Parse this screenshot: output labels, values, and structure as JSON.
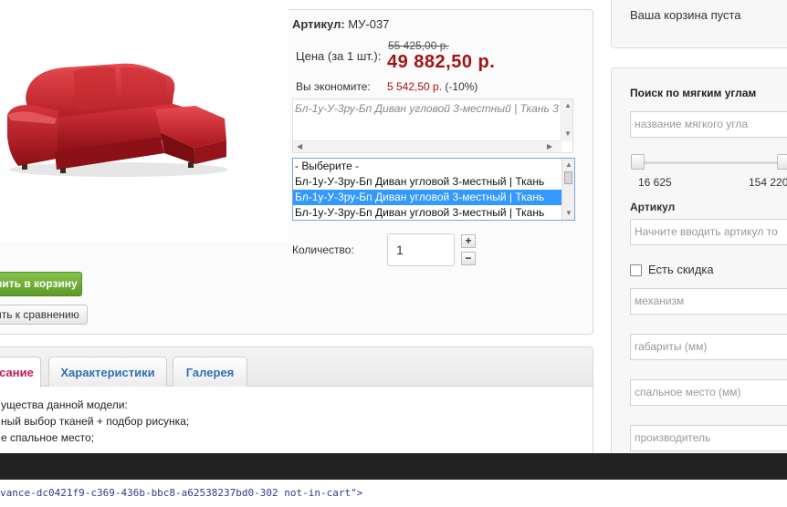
{
  "product": {
    "sku_label": "Артикул:",
    "sku_value": "МУ-037",
    "price_label": "Цена (за 1 шт.):",
    "old_price": "55 425,00 р.",
    "new_price": "49 882,50 р.",
    "save_label": "Вы экономите:",
    "save_amount": "5 542,50 р.",
    "save_percent": "(-10%)",
    "description": "Бл-1у-У-3ру-Бп Диван угловой 3-местный | Ткань 3",
    "variant_options": [
      "- Выберите -",
      "Бл-1у-У-3ру-Бп Диван угловой 3-местный | Ткань",
      "Бл-1у-У-3ру-Бп Диван угловой 3-местный | Ткань",
      "Бл-1у-У-3ру-Бп Диван угловой 3-местный | Ткань"
    ],
    "selected_variant_index": 2,
    "quantity_label": "Количество:",
    "quantity_value": "1",
    "plus": "+",
    "minus": "−",
    "cart_button": "вить в корзину",
    "compare_button": "ить к сравнению"
  },
  "tabs": {
    "items": [
      "сание",
      "Характеристики",
      "Галерея"
    ],
    "active_index": 0,
    "content_lines": [
      "ущества данной модели:",
      "ный выбор тканей + подбор рисунка;",
      "е спальное место;"
    ]
  },
  "sidebar": {
    "cart_status": "Ваша корзина пуста",
    "filter_title": "Поиск по мягким углам",
    "name_placeholder": "название мягкого угла",
    "price_min": "16 625",
    "price_max": "154 220",
    "sku_label": "Артикул",
    "sku_placeholder": "Начните вводить артикул то",
    "discount_label": "Есть скидка",
    "mechanism_placeholder": "механизм",
    "dimensions_placeholder": "габариты (мм)",
    "sleeping_placeholder": "спальное место (мм)",
    "manufacturer_placeholder": "производитель"
  },
  "devtools": {
    "code_line": "vance-dc0421f9-c369-436b-bbc8-a62538237bd0-302 not-in-cart\">"
  },
  "colors": {
    "price_red": "#a31212",
    "tab_blue": "#2e6fb8",
    "tab_active": "#c3185c",
    "cart_green": "#5b9b26",
    "selection_blue": "#3399ff"
  }
}
